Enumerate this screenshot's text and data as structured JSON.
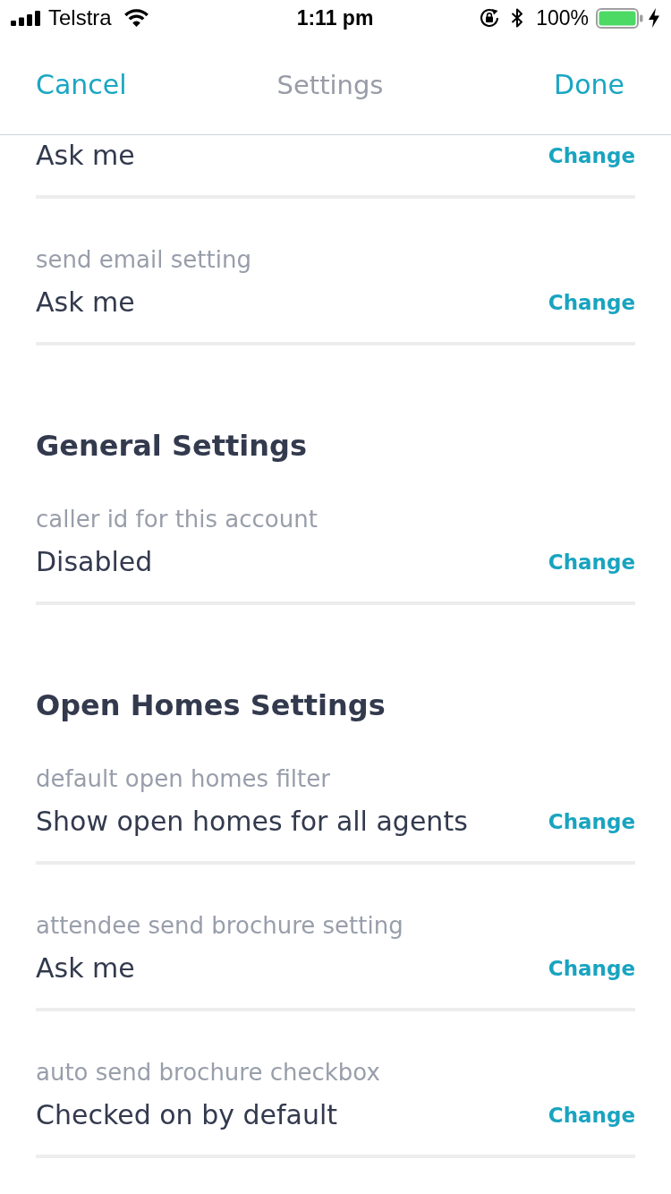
{
  "status_bar": {
    "carrier": "Telstra",
    "time": "1:11 pm",
    "battery": "100%"
  },
  "nav_bar": {
    "cancel": "Cancel",
    "title": "Settings",
    "done": "Done"
  },
  "sections": [
    {
      "rows": [
        {
          "value": "Ask me",
          "action": "Change"
        },
        {
          "label": "send email setting",
          "value": "Ask me",
          "action": "Change"
        }
      ]
    },
    {
      "heading": "General Settings",
      "rows": [
        {
          "label": "caller id for this account",
          "value": "Disabled",
          "action": "Change"
        }
      ]
    },
    {
      "heading": "Open Homes Settings",
      "rows": [
        {
          "label": "default open homes filter",
          "value": "Show open homes for all agents",
          "action": "Change"
        },
        {
          "label": "attendee send brochure setting",
          "value": "Ask me",
          "action": "Change"
        },
        {
          "label": "auto send brochure checkbox",
          "value": "Checked on by default",
          "action": "Change"
        }
      ]
    }
  ]
}
